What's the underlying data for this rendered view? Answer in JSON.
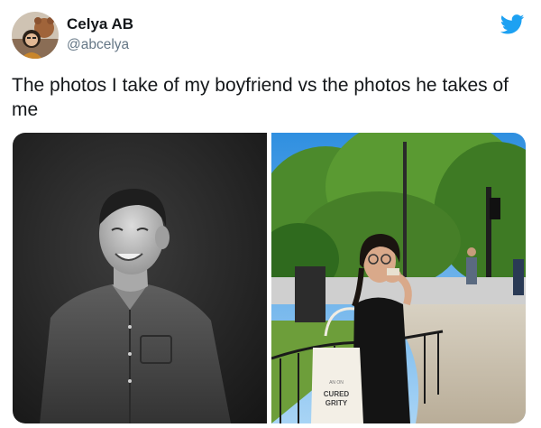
{
  "tweet": {
    "author_name": "Celya AB",
    "author_handle": "@abcelya",
    "text": "The photos I take of my boyfriend vs the photos he takes of me",
    "bird_icon": "twitter-bird-icon",
    "brand_color": "#1da1f2"
  },
  "media": {
    "left_photo_icon": "photo-man-black-and-white",
    "right_photo_icon": "photo-woman-in-park",
    "bag_text_top": "AN ON",
    "bag_text_main": "CURED",
    "bag_text_sub": "GRITY"
  }
}
